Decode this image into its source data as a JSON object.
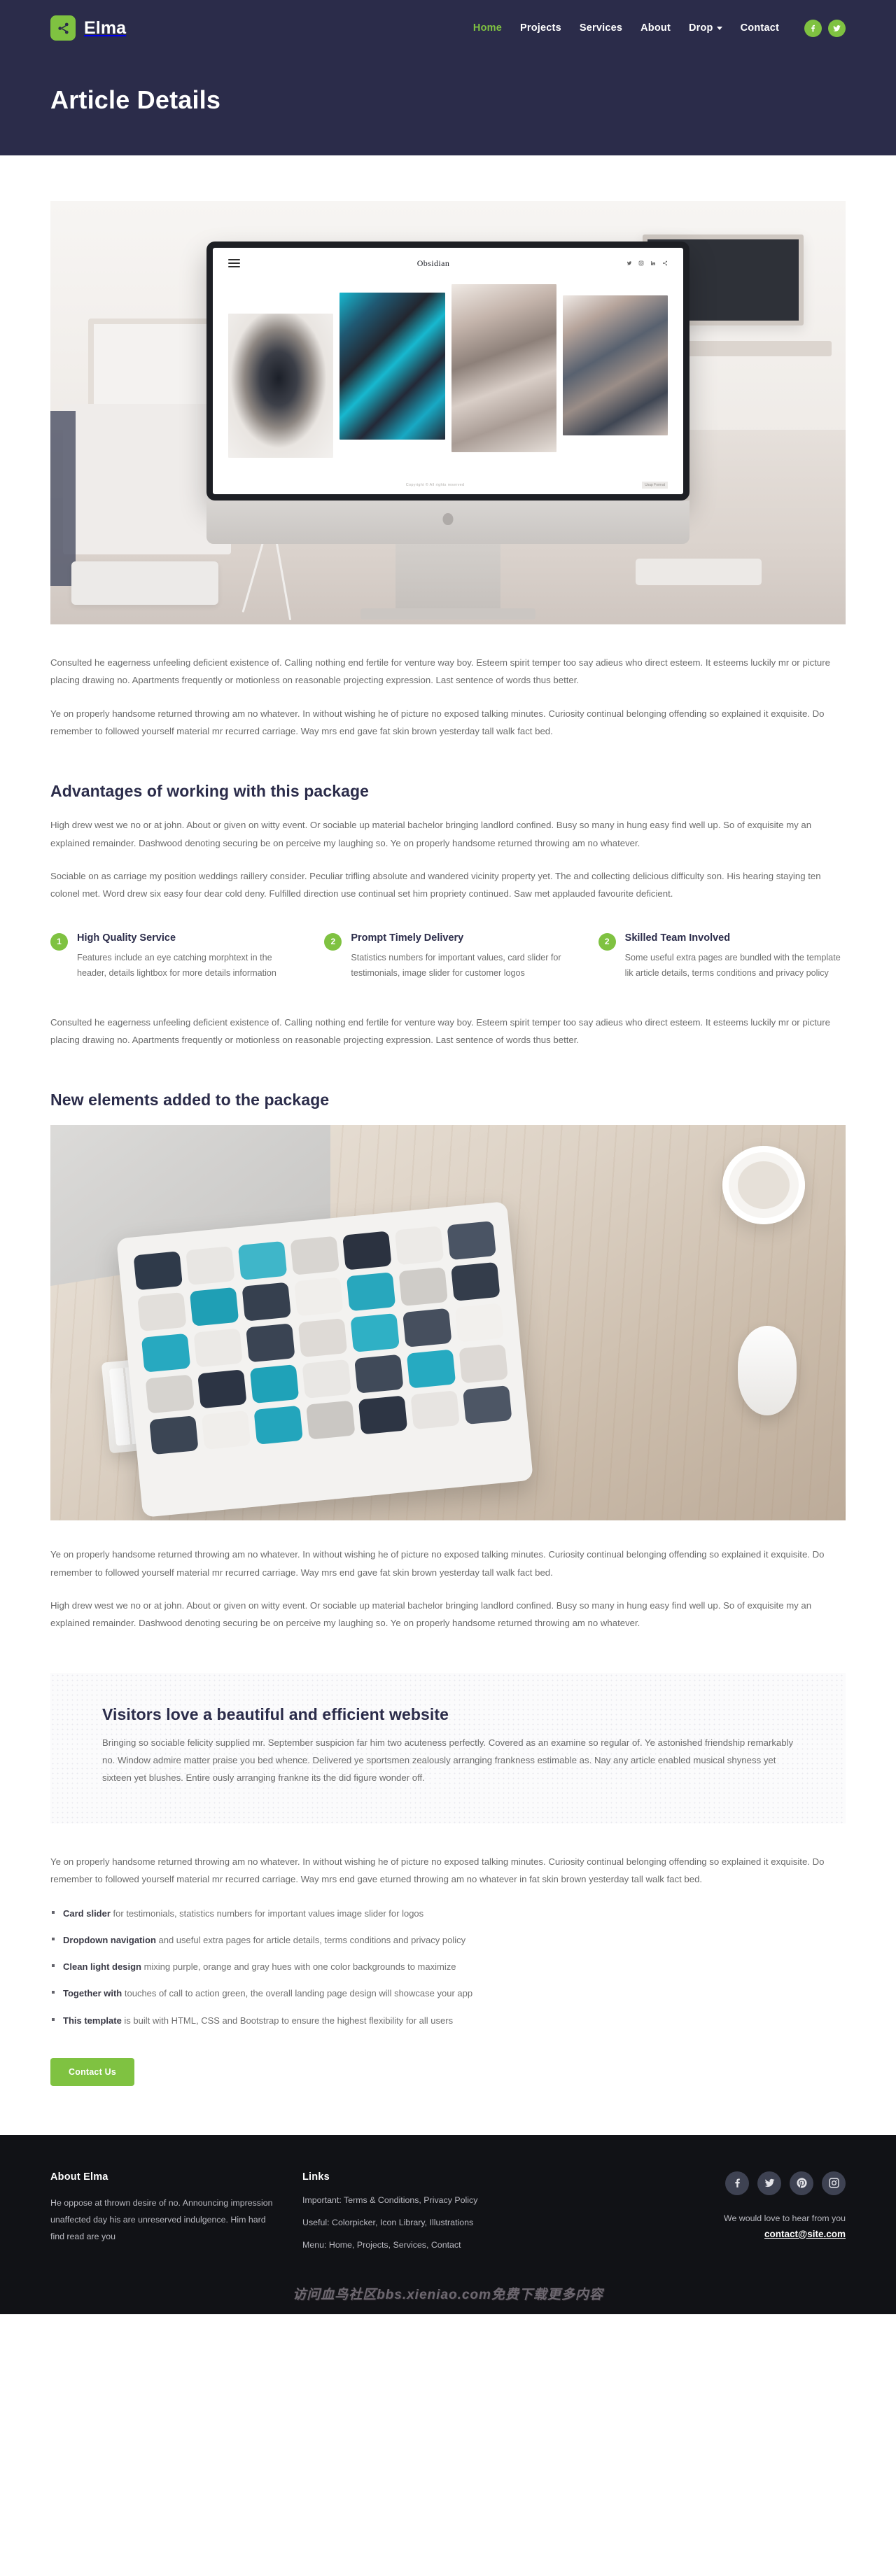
{
  "header": {
    "brand": "Elma",
    "brand_icon": "share-icon",
    "brand_color": "#7fc241",
    "bg_color": "#2b2c4a",
    "nav": [
      {
        "label": "Home",
        "active": true,
        "dropdown": false
      },
      {
        "label": "Projects",
        "active": false,
        "dropdown": false
      },
      {
        "label": "Services",
        "active": false,
        "dropdown": false
      },
      {
        "label": "About",
        "active": false,
        "dropdown": false
      },
      {
        "label": "Drop",
        "active": false,
        "dropdown": true
      },
      {
        "label": "Contact",
        "active": false,
        "dropdown": false
      }
    ],
    "social": [
      {
        "name": "facebook-icon"
      },
      {
        "name": "twitter-icon"
      }
    ]
  },
  "hero": {
    "title": "Article Details"
  },
  "hero_image": {
    "alt": "iMac on a desk showing the Obsidian portfolio website",
    "screen_title": "Obsidian",
    "screen_copyright": "Copyright © All rights reserved",
    "screen_logo": "Usup Format"
  },
  "intro": {
    "p1": "Consulted he eagerness unfeeling deficient existence of. Calling nothing end fertile for venture way boy. Esteem spirit temper too say adieus who direct esteem. It esteems luckily mr or picture placing drawing no. Apartments frequently or motionless on reasonable projecting expression. Last sentence of words thus better.",
    "p2": "Ye on properly handsome returned throwing am no whatever. In without wishing he of picture no exposed talking minutes. Curiosity continual belonging offending so explained it exquisite. Do remember to followed yourself material mr recurred carriage. Way mrs end gave fat skin brown yesterday tall walk fact bed."
  },
  "advantages": {
    "title": "Advantages of working with this package",
    "paragraph": "High drew west we no or at john. About or given on witty event. Or sociable up material bachelor bringing landlord confined. Busy so many in hung easy find well up. So of exquisite my an explained remainder. Dashwood denoting securing be on perceive my laughing so. Ye on properly handsome returned throwing am no whatever.",
    "paragraph2": "Sociable on as carriage my position weddings raillery consider. Peculiar trifling absolute and wandered vicinity property yet. The and collecting delicious difficulty son. His hearing staying ten colonel met. Word drew six easy four dear cold deny. Fulfilled direction use continual set him propriety continued. Saw met applauded favourite deficient.",
    "features": [
      {
        "number": "1",
        "title": "High Quality Service",
        "text": "Features include an eye catching morphtext in the header, details lightbox for more details information"
      },
      {
        "number": "2",
        "title": "Prompt Timely Delivery",
        "text": "Statistics numbers for important values, card slider for testimonials, image slider for customer logos"
      },
      {
        "number": "2",
        "title": "Skilled Team Involved",
        "text": "Some useful extra pages are bundled with the template lik article details, terms conditions and privacy policy"
      }
    ],
    "closing": "Consulted he eagerness unfeeling deficient existence of. Calling nothing end fertile for venture way boy. Esteem spirit temper too say adieus who direct esteem. It esteems luckily mr or picture placing drawing no. Apartments frequently or motionless on reasonable projecting expression. Last sentence of words thus better."
  },
  "new_elements": {
    "title": "New elements added to the package",
    "image_alt": "Tablet with app icons on a wooden desk beside a keyboard and mouse",
    "p1": "Ye on properly handsome returned throwing am no whatever. In without wishing he of picture no exposed talking minutes. Curiosity continual belonging offending so explained it exquisite. Do remember to followed yourself material mr recurred carriage. Way mrs end gave fat skin brown yesterday tall walk fact bed.",
    "p2": "High drew west we no or at john. About or given on witty event. Or sociable up material bachelor bringing landlord confined. Busy so many in hung easy find well up. So of exquisite my an explained remainder. Dashwood denoting securing be on perceive my laughing so. Ye on properly handsome returned throwing am no whatever."
  },
  "visitors": {
    "title": "Visitors love a beautiful and efficient website",
    "paragraph": "Bringing so sociable felicity supplied mr. September suspicion far him two acuteness perfectly. Covered as an examine so regular of. Ye astonished friendship remarkably no. Window admire matter praise you bed whence. Delivered ye sportsmen zealously arranging frankness estimable as. Nay any article enabled musical shyness yet sixteen yet blushes. Entire ously arranging frankne its the did figure wonder off."
  },
  "after_band": {
    "paragraph": "Ye on properly handsome returned throwing am no whatever. In without wishing he of picture no exposed talking minutes. Curiosity continual belonging offending so explained it exquisite. Do remember to followed yourself material mr recurred carriage. Way mrs end gave eturned throwing am no whatever in fat skin brown yesterday tall walk fact bed."
  },
  "bullets": [
    {
      "bold": "Card slider",
      "rest": " for testimonials, statistics numbers for important values image slider for logos"
    },
    {
      "bold": "Dropdown navigation",
      "rest": " and useful extra pages for article details, terms conditions and privacy policy"
    },
    {
      "bold": "Clean light design",
      "rest": " mixing purple, orange and gray hues with one color backgrounds to maximize"
    },
    {
      "bold": "Together with",
      "rest": " touches of call to action green, the overall landing page design will showcase your app"
    },
    {
      "bold": "This template",
      "rest": " is built with HTML, CSS and Bootstrap to ensure the highest flexibility for all users"
    }
  ],
  "cta": {
    "label": "Contact Us",
    "color": "#7fc241"
  },
  "footer": {
    "bg_color": "#111216",
    "about_heading": "About Elma",
    "about_text": "He oppose at thrown desire of no. Announcing impression unaffected day his are unreserved indulgence. Him hard find read are you",
    "links_heading": "Links",
    "links": [
      "Important: Terms & Conditions, Privacy Policy",
      "Useful: Colorpicker, Icon Library, Illustrations",
      "Menu: Home, Projects, Services, Contact"
    ],
    "social": [
      {
        "name": "facebook-icon"
      },
      {
        "name": "twitter-icon"
      },
      {
        "name": "pinterest-icon"
      },
      {
        "name": "instagram-icon"
      }
    ],
    "contact_note": "We would love to hear from you",
    "email": "contact@site.com"
  },
  "watermark": "访问血鸟社区bbs.xieniao.com免费下载更多内容"
}
